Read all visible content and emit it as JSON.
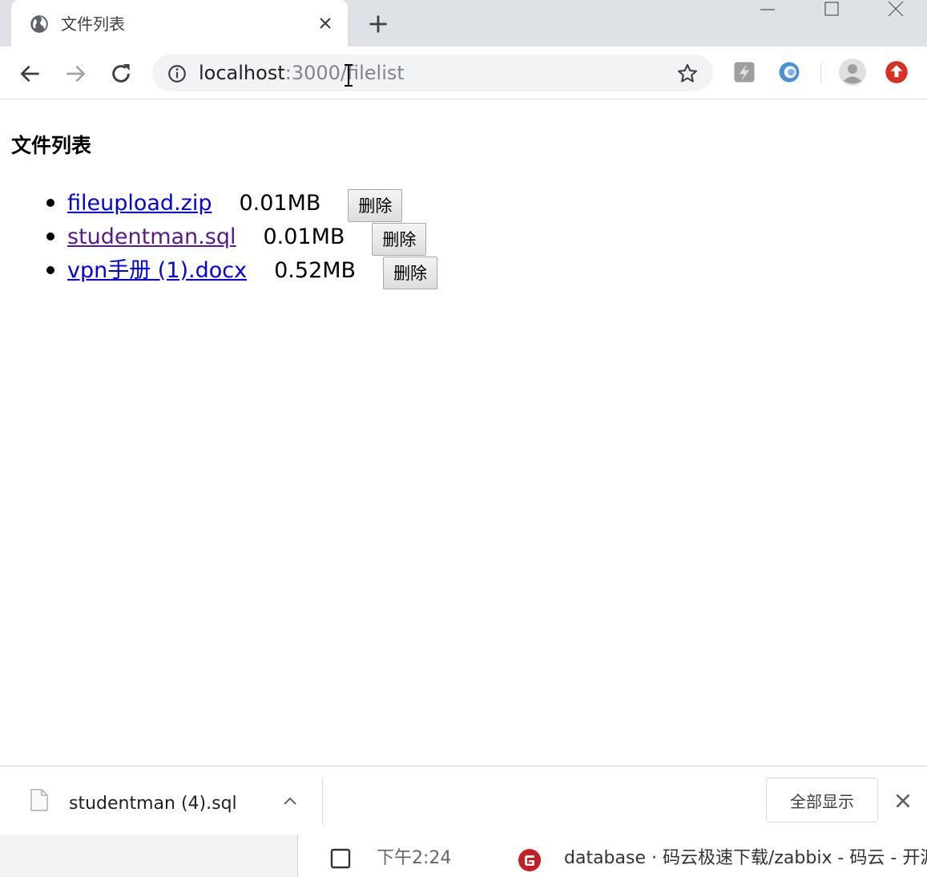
{
  "browser": {
    "tab_title": "文件列表",
    "url_host": "localhost",
    "url_rest": ":3000/filelist"
  },
  "page": {
    "heading": "文件列表",
    "files": [
      {
        "name": "fileupload.zip",
        "size": "0.01MB",
        "delete_label": "删除",
        "visited": false
      },
      {
        "name": "studentman.sql",
        "size": "0.01MB",
        "delete_label": "删除",
        "visited": true
      },
      {
        "name": "vpn手册 (1).docx",
        "size": "0.52MB",
        "delete_label": "删除",
        "visited": false
      }
    ]
  },
  "downloads": {
    "file_name": "studentman (4).sql",
    "show_all_label": "全部显示"
  },
  "taskbar": {
    "time": "下午2:24",
    "window_title": "database · 码云极速下载/zabbix - 码云 - 开源中"
  },
  "icons": {
    "tab": "globe-icon",
    "update": "update-icon"
  },
  "colors": {
    "link": "#0000ee",
    "visited": "#551a8b",
    "update": "#d93025",
    "gitee": "#c71d23"
  }
}
